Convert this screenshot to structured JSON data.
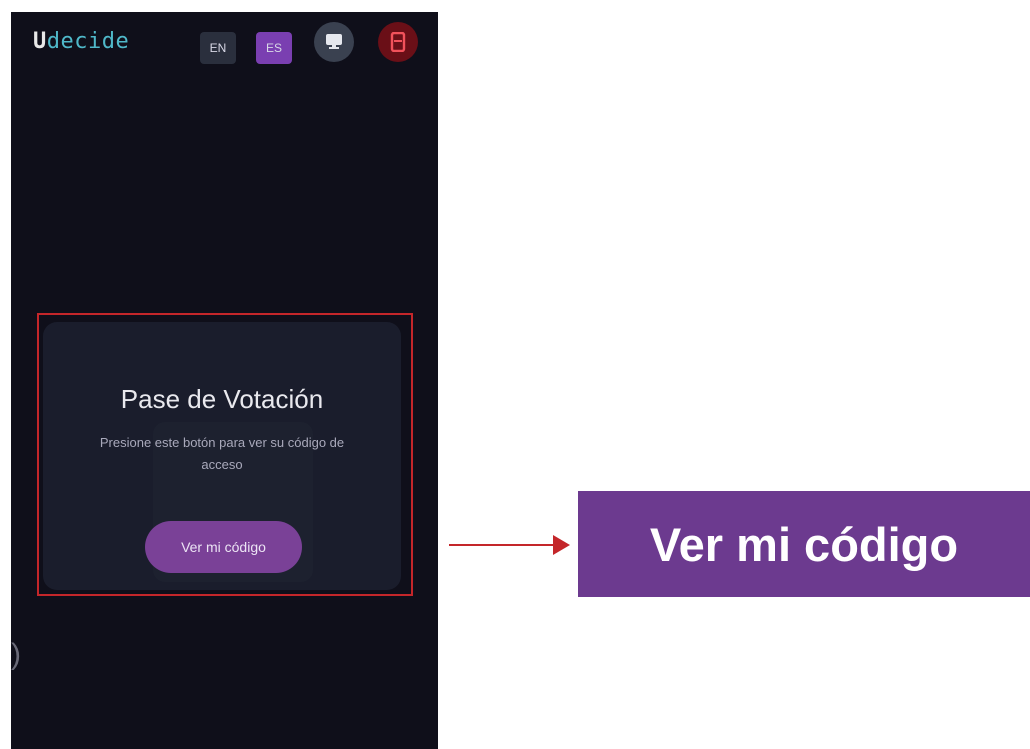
{
  "app": {
    "brand_first": "U",
    "brand_rest": "decide"
  },
  "header": {
    "lang_en": "EN",
    "lang_es": "ES"
  },
  "card": {
    "title": "Pase de Votación",
    "description": "Presione este botón para ver su código de acceso",
    "button_label": "Ver mi código"
  },
  "edge_char": ")",
  "callout": {
    "label": "Ver mi código"
  },
  "colors": {
    "background": "#0f0f1a",
    "accent": "#7a4197",
    "highlight": "#c4262a",
    "callout_bg": "#6c3a8f"
  },
  "icons": [
    "monitor-icon",
    "tablet-icon",
    "arrow-right-icon"
  ]
}
